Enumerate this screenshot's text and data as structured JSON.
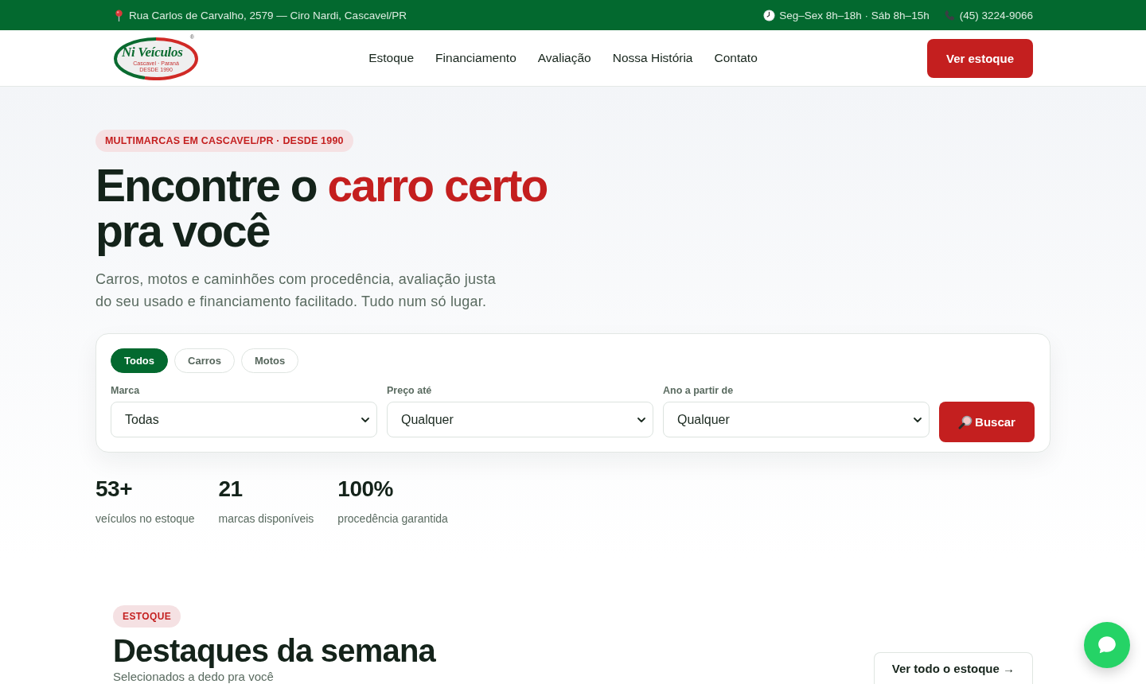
{
  "top_bar": {
    "address": "Rua Carlos de Carvalho, 2579 — Ciro Nardi, Cascavel/PR",
    "hours": "Seg–Sex 8h–18h · Sáb 8h–15h",
    "phone": "(45) 3224-9066"
  },
  "header": {
    "logo": {
      "wordmark": "Ni Veículos",
      "registered": "®",
      "captions": [
        "Cascavel · Paraná",
        "DESDE 1990"
      ]
    },
    "nav": [
      "Estoque",
      "Financiamento",
      "Avaliação",
      "Nossa História",
      "Contato"
    ],
    "cta": "Ver estoque"
  },
  "hero": {
    "badge": "MULTIMARCAS EM CASCAVEL/PR · DESDE 1990",
    "headline": [
      {
        "text": "Encontre o ",
        "highlight": false
      },
      {
        "text": "carro certo",
        "highlight": true
      },
      {
        "text": " pra você",
        "highlight": false
      }
    ],
    "subtitle": "Carros, motos e caminhões com procedência, avaliação justa do seu usado e financiamento facilitado. Tudo num só lugar.",
    "search": {
      "tabs": [
        {
          "label": "Todos",
          "selected": true
        },
        {
          "label": "Carros",
          "selected": false
        },
        {
          "label": "Motos",
          "selected": false
        }
      ],
      "fields": [
        {
          "label": "Marca",
          "value": "Todas"
        },
        {
          "label": "Preço até",
          "value": "Qualquer"
        },
        {
          "label": "Ano a partir de",
          "value": "Qualquer"
        }
      ],
      "button": "Buscar"
    },
    "stats": [
      {
        "value": "53+",
        "label": "veículos no estoque"
      },
      {
        "value": "21",
        "label": "marcas disponíveis"
      },
      {
        "value": "100%",
        "label": "procedência garantida"
      }
    ]
  },
  "featured": {
    "badge": "ESTOQUE",
    "title": "Destaques da semana",
    "subtitle": "Selecionados a dedo pra você",
    "button": "Ver todo o estoque →"
  }
}
